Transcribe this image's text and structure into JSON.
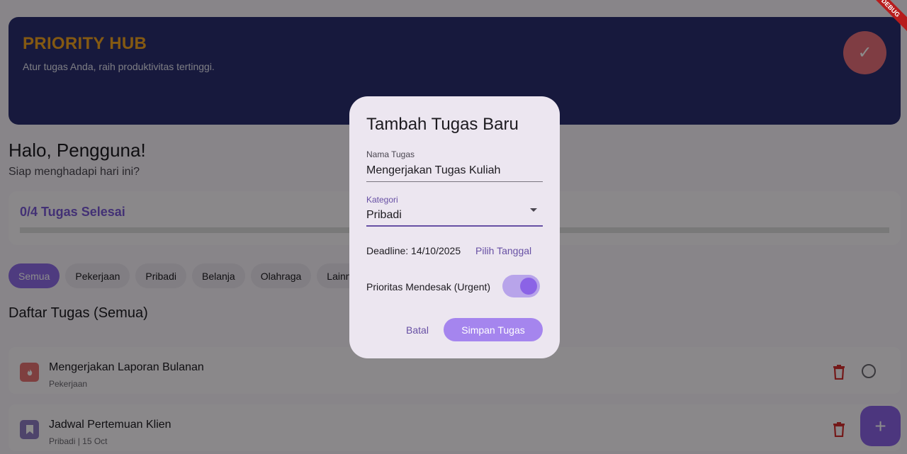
{
  "app": {
    "title": "PRIORITY HUB",
    "subtitle": "Atur tugas Anda, raih produktivitas tertinggi.",
    "debug_banner": "DEBUG"
  },
  "greeting": {
    "title": "Halo, Pengguna!",
    "subtitle": "Siap menghadapi hari ini?"
  },
  "progress": {
    "label": "0/4 Tugas Selesai",
    "completed": 0,
    "total": 4
  },
  "filters": {
    "chips": [
      {
        "label": "Semua",
        "active": true
      },
      {
        "label": "Pekerjaan",
        "active": false
      },
      {
        "label": "Pribadi",
        "active": false
      },
      {
        "label": "Belanja",
        "active": false
      },
      {
        "label": "Olahraga",
        "active": false
      },
      {
        "label": "Lainnya",
        "active": false
      }
    ]
  },
  "task_list": {
    "title": "Daftar Tugas (Semua)",
    "tasks": [
      {
        "name": "Mengerjakan Laporan Bulanan",
        "meta": "Pekerjaan",
        "icon": "flame-icon",
        "color": "#e57373"
      },
      {
        "name": "Jadwal Pertemuan Klien",
        "meta": "Pribadi  | 15 Oct",
        "icon": "bookmark-icon",
        "color": "#8e7cc3"
      }
    ]
  },
  "dialog": {
    "title": "Tambah Tugas Baru",
    "name_label": "Nama Tugas",
    "name_value": "Mengerjakan Tugas Kuliah",
    "category_label": "Kategori",
    "category_value": "Pribadi",
    "deadline_text": "Deadline: 14/10/2025",
    "pick_date_label": "Pilih Tanggal",
    "urgent_label": "Prioritas Mendesak (Urgent)",
    "urgent_on": true,
    "cancel_label": "Batal",
    "save_label": "Simpan Tugas"
  },
  "colors": {
    "hero_bg": "#2b2e70",
    "hero_title": "#f0a322",
    "accent": "#8b63e6",
    "danger": "#d32f2f"
  }
}
